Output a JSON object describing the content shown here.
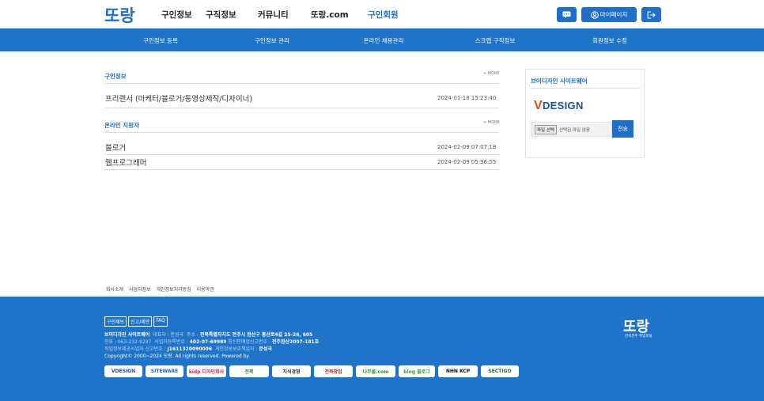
{
  "header": {
    "logo_text": "또랑",
    "nav": [
      "구인정보",
      "구직정보",
      "커뮤니티",
      "또랑.com",
      "구인회원"
    ],
    "active_nav": "구인회원",
    "btn_message_icon": "message-icon",
    "btn_mypage": "마이페이지",
    "btn_logout_icon": "logout-icon"
  },
  "subnav": [
    "구인정보 등록",
    "구인정보 관리",
    "온라인 채용관리",
    "스크랩 구직정보",
    "회원정보 수정"
  ],
  "jobs": {
    "title": "구인정보",
    "more": "+ MORE",
    "rows": [
      {
        "title": "프리랜서 (마케터/블로거/동영상제작/디자이너)",
        "date": "2024-01-18 15:23:40"
      }
    ]
  },
  "applicants": {
    "title": "온라인 지원자",
    "more": "+ MORE",
    "rows": [
      {
        "title": "블로거",
        "date": "2024-02-09 07:07:18"
      },
      {
        "title": "웹프로그래머",
        "date": "2024-02-09 05:36:55"
      }
    ]
  },
  "sidebox": {
    "title": "브이디자인 사이트웨어",
    "logo_text": "DESIGN",
    "file_button": "파일 선택",
    "file_status": "선택된 파일 없음",
    "send": "전송"
  },
  "footer_links": [
    "회사소개",
    "사업자정보",
    "개인정보처리방침",
    "이용약관"
  ],
  "footer": {
    "tabs": [
      "구인제보",
      "신고/제안",
      "FAQ"
    ],
    "line1_company": "브이디자인 사이트웨어",
    "line1_ceo": "대표자 : 문성국",
    "line1_addr_label": "주소 :",
    "line1_addr": "전북특별자치도 전주시 완산구 홍산로4길 25-26, 605",
    "line2_tel": "전화 : 063-232-9297",
    "line2_biz_label": "사업자등록번호 :",
    "line2_biz": "402-07-69989",
    "line2_mail_label": "통신판매업신고번호 :",
    "line2_mail": "전주완산2007-181호",
    "line3_job_label": "직업정보제공사업자 신고번호 :",
    "line3_job": "J1611320090006",
    "line3_priv_label": "개인정보보호책임자 :",
    "line3_priv": "문성국",
    "copyright": "Copyright© 2000~2024 또랑. All rights reserved. Powered by",
    "logo_text": "또랑",
    "logo_sub": "전북전주 취업포털",
    "badges": [
      "VDESIGN",
      "SITEWARE",
      "kidp 디자인회사",
      "전북",
      "지식경영",
      "전북창업",
      "나무몰.com",
      "blog 블로그",
      "NHN KCP",
      "SECTIGO"
    ]
  }
}
